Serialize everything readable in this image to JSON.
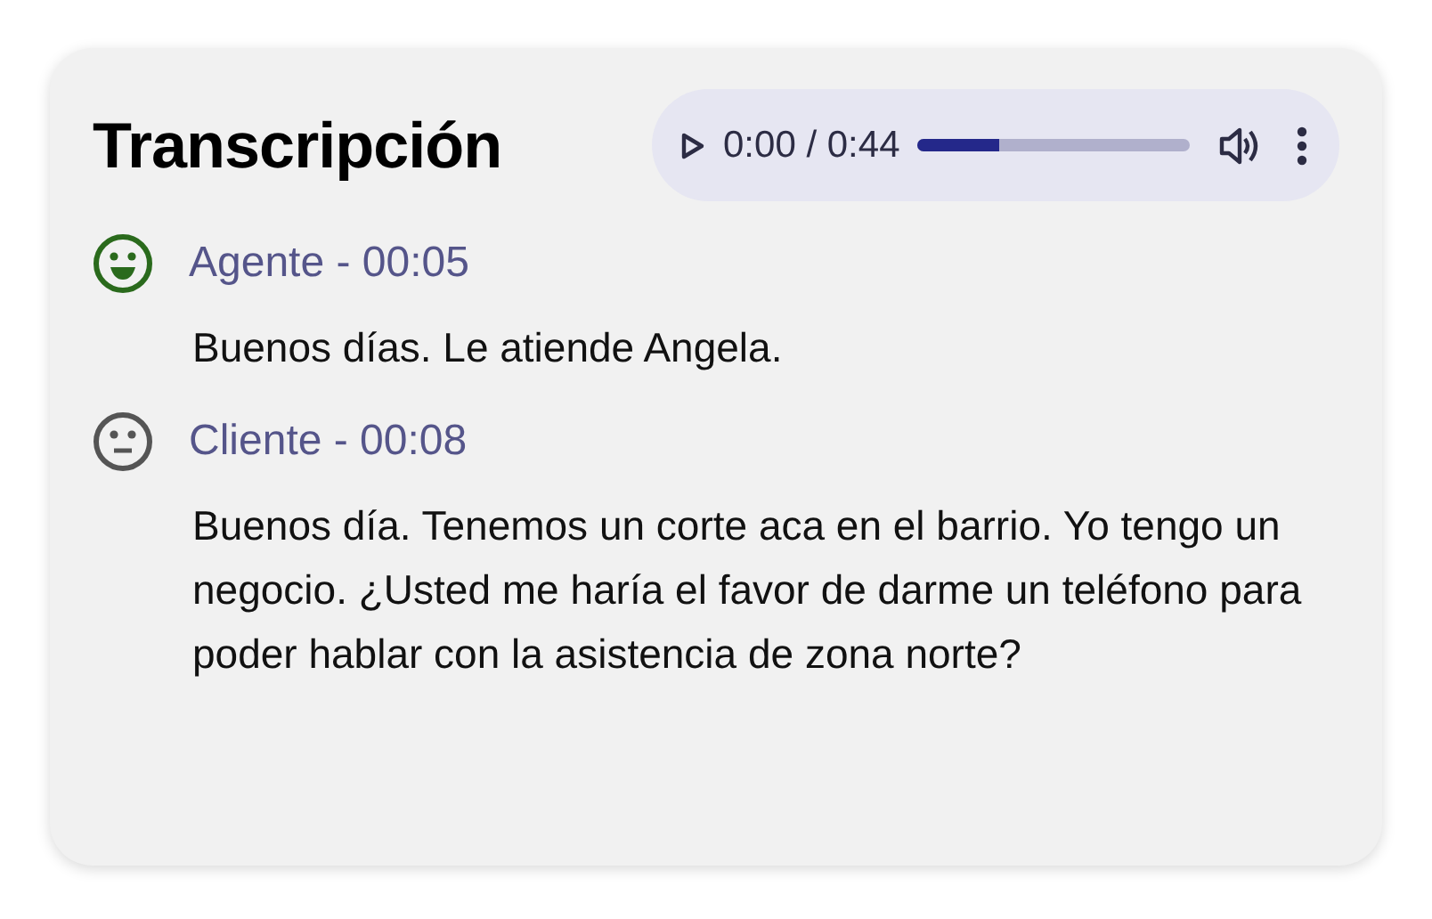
{
  "title": "Transcripción",
  "player": {
    "time": "0:00 / 0:44",
    "level": 0.3
  },
  "entries": [
    {
      "kind": "happy",
      "header": "Agente - 00:05",
      "text": "Buenos días. Le atiende Angela."
    },
    {
      "kind": "neutral",
      "header": "Cliente - 00:08",
      "text": "Buenos día. Tenemos un corte aca en el barrio. Yo tengo un negocio. ¿Usted me haría el favor de darme un teléfono para poder hablar con la asistencia de zona norte?"
    }
  ]
}
